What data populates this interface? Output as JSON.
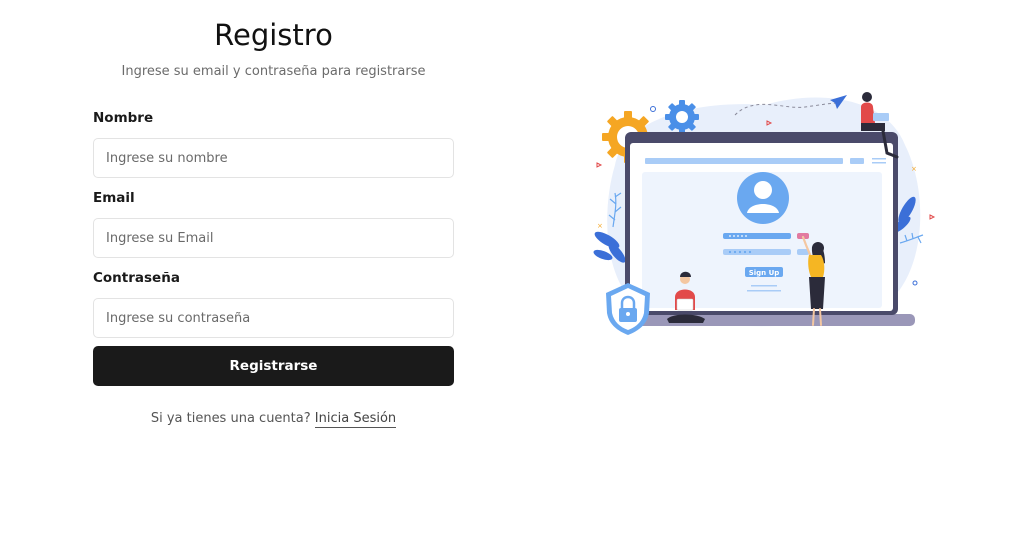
{
  "page": {
    "title": "Registro",
    "subtitle": "Ingrese su email y contraseña para registrarse"
  },
  "form": {
    "name": {
      "label": "Nombre",
      "placeholder": "Ingrese su nombre",
      "value": ""
    },
    "email": {
      "label": "Email",
      "placeholder": "Ingrese su Email",
      "value": ""
    },
    "password": {
      "label": "Contraseña",
      "placeholder": "Ingrese su contraseña",
      "value": ""
    },
    "submit_label": "Registrarse"
  },
  "footer": {
    "prompt": "Si ya tienes una cuenta?",
    "login_link": "Inicia Sesión"
  },
  "illustration": {
    "signup_button_text": "Sign Up",
    "colors": {
      "blob": "#e8effb",
      "laptop_frame": "#4a4a6a",
      "accent_blue": "#6aa8f0",
      "gear_orange": "#f5a623",
      "leaf_blue": "#3b6fd8",
      "shirt_red": "#e24a4a"
    }
  },
  "colors": {
    "button_bg": "#1a1a1a",
    "button_text": "#ffffff",
    "input_border": "#e3e3e3"
  }
}
